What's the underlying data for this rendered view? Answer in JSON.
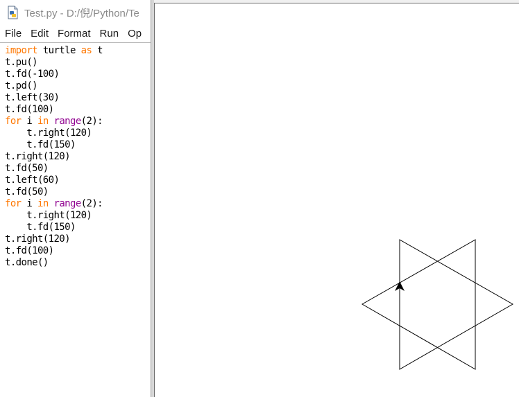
{
  "editor": {
    "title": "Test.py - D:/倪/Python/Te",
    "icon": "python-file-icon",
    "menu": [
      "File",
      "Edit",
      "Format",
      "Run",
      "Op"
    ],
    "code_lines": [
      [
        [
          "import",
          "kw"
        ],
        [
          " turtle ",
          ""
        ],
        [
          "as",
          "kw"
        ],
        [
          " t",
          ""
        ]
      ],
      [
        [
          "t.pu()",
          ""
        ]
      ],
      [
        [
          "t.fd(-100)",
          ""
        ]
      ],
      [
        [
          "t.pd()",
          ""
        ]
      ],
      [
        [
          "t.left(30)",
          ""
        ]
      ],
      [
        [
          "t.fd(100)",
          ""
        ]
      ],
      [
        [
          "for",
          "kw"
        ],
        [
          " i ",
          ""
        ],
        [
          "in",
          "kw"
        ],
        [
          " ",
          ""
        ],
        [
          "range",
          "bi"
        ],
        [
          "(2):",
          ""
        ]
      ],
      [
        [
          "    t.right(120)",
          ""
        ]
      ],
      [
        [
          "    t.fd(150)",
          ""
        ]
      ],
      [
        [
          "t.right(120)",
          ""
        ]
      ],
      [
        [
          "t.fd(50)",
          ""
        ]
      ],
      [
        [
          "t.left(60)",
          ""
        ]
      ],
      [
        [
          "t.fd(50)",
          ""
        ]
      ],
      [
        [
          "for",
          "kw"
        ],
        [
          " i ",
          ""
        ],
        [
          "in",
          "kw"
        ],
        [
          " ",
          ""
        ],
        [
          "range",
          "bi"
        ],
        [
          "(2):",
          ""
        ]
      ],
      [
        [
          "    t.right(120)",
          ""
        ]
      ],
      [
        [
          "    t.fd(150)",
          ""
        ]
      ],
      [
        [
          "t.right(120)",
          ""
        ]
      ],
      [
        [
          "t.fd(100)",
          ""
        ]
      ],
      [
        [
          "t.done()",
          ""
        ]
      ]
    ]
  },
  "colors": {
    "keyword": "#ff7700",
    "builtin": "#900090",
    "text": "#000000",
    "drawing": "#000000"
  },
  "turtle_canvas": {
    "drawing": "six-pointed-star",
    "cursor": "turtle-arrow-icon"
  }
}
